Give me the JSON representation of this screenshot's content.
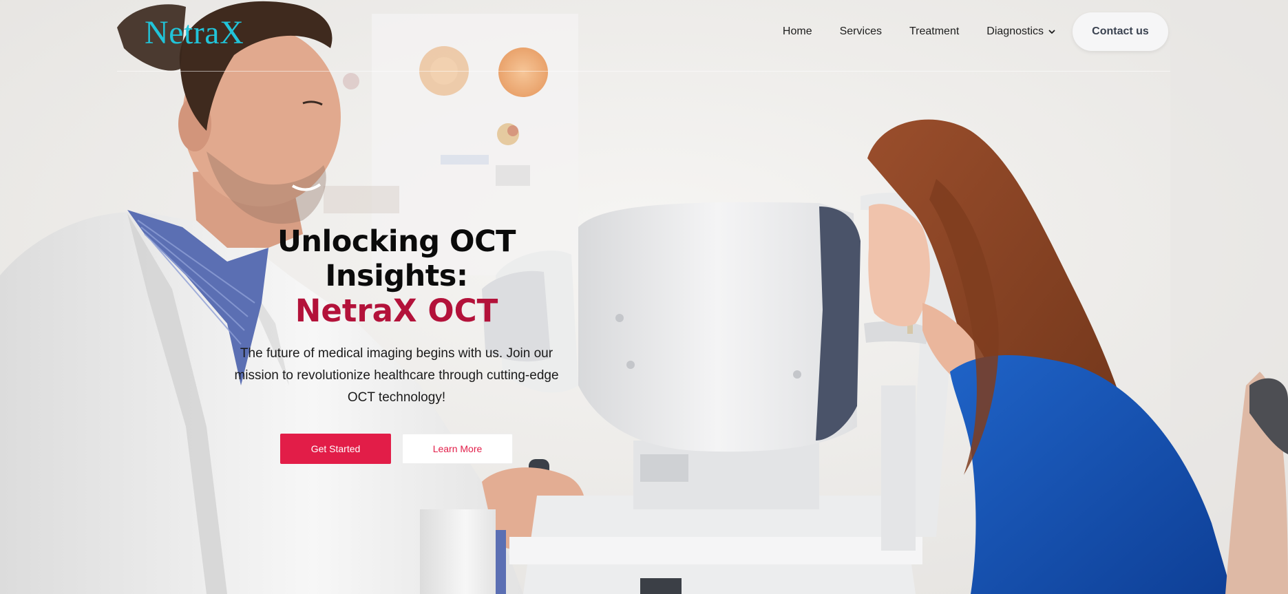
{
  "header": {
    "logo": "NetraX",
    "nav": [
      {
        "label": "Home"
      },
      {
        "label": "Services"
      },
      {
        "label": "Treatment"
      },
      {
        "label": "Diagnostics",
        "has_dropdown": true
      }
    ],
    "contact_label": "Contact us"
  },
  "hero": {
    "title": "Unlocking OCT Insights:",
    "title_accent": "NetraX OCT",
    "description": "The future of medical imaging begins with us. Join our mission to revolutionize healthcare through cutting-edge OCT technology!",
    "primary_button": "Get Started",
    "secondary_button": "Learn More"
  },
  "colors": {
    "logo": "#21c4d9",
    "accent": "#b3123a",
    "primary_button": "#e21d48",
    "contact_button_bg": "#f6f6f7"
  },
  "icons": {
    "dropdown": "chevron-down-icon"
  },
  "background": {
    "description_icon": "hero-background-image"
  }
}
